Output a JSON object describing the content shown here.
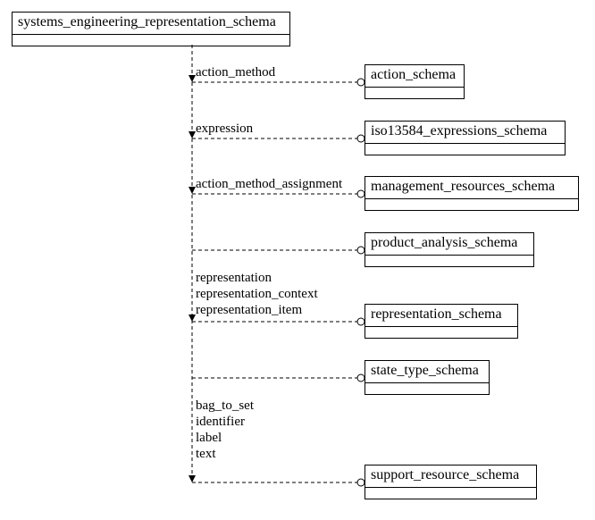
{
  "source_schema": {
    "name": "systems_engineering_representation_schema"
  },
  "targets": [
    {
      "id": "action",
      "name": "action_schema"
    },
    {
      "id": "iso",
      "name": "iso13584_expressions_schema"
    },
    {
      "id": "mgmt",
      "name": "management_resources_schema"
    },
    {
      "id": "product",
      "name": "product_analysis_schema"
    },
    {
      "id": "repr",
      "name": "representation_schema"
    },
    {
      "id": "statetype",
      "name": "state_type_schema"
    },
    {
      "id": "support",
      "name": "support_resource_schema"
    }
  ],
  "edges": [
    {
      "target": "action",
      "labels": [
        "action_method"
      ]
    },
    {
      "target": "iso",
      "labels": [
        "expression"
      ]
    },
    {
      "target": "mgmt",
      "labels": [
        "action_method_assignment"
      ]
    },
    {
      "target": "product",
      "labels": []
    },
    {
      "target": "repr",
      "labels": [
        "representation",
        "representation_context",
        "representation_item"
      ]
    },
    {
      "target": "statetype",
      "labels": []
    },
    {
      "target": "support",
      "labels": [
        "bag_to_set",
        "identifier",
        "label",
        "text"
      ]
    }
  ],
  "chart_data": {
    "type": "diagram",
    "description": "EXPRESS-G schema reference diagram: source schema references seven external schemas via dashed connectors, each annotated with the imported entity names.",
    "source": "systems_engineering_representation_schema",
    "references": [
      {
        "target_schema": "action_schema",
        "imports": [
          "action_method"
        ]
      },
      {
        "target_schema": "iso13584_expressions_schema",
        "imports": [
          "expression"
        ]
      },
      {
        "target_schema": "management_resources_schema",
        "imports": [
          "action_method_assignment"
        ]
      },
      {
        "target_schema": "product_analysis_schema",
        "imports": []
      },
      {
        "target_schema": "representation_schema",
        "imports": [
          "representation",
          "representation_context",
          "representation_item"
        ]
      },
      {
        "target_schema": "state_type_schema",
        "imports": []
      },
      {
        "target_schema": "support_resource_schema",
        "imports": [
          "bag_to_set",
          "identifier",
          "label",
          "text"
        ]
      }
    ]
  }
}
